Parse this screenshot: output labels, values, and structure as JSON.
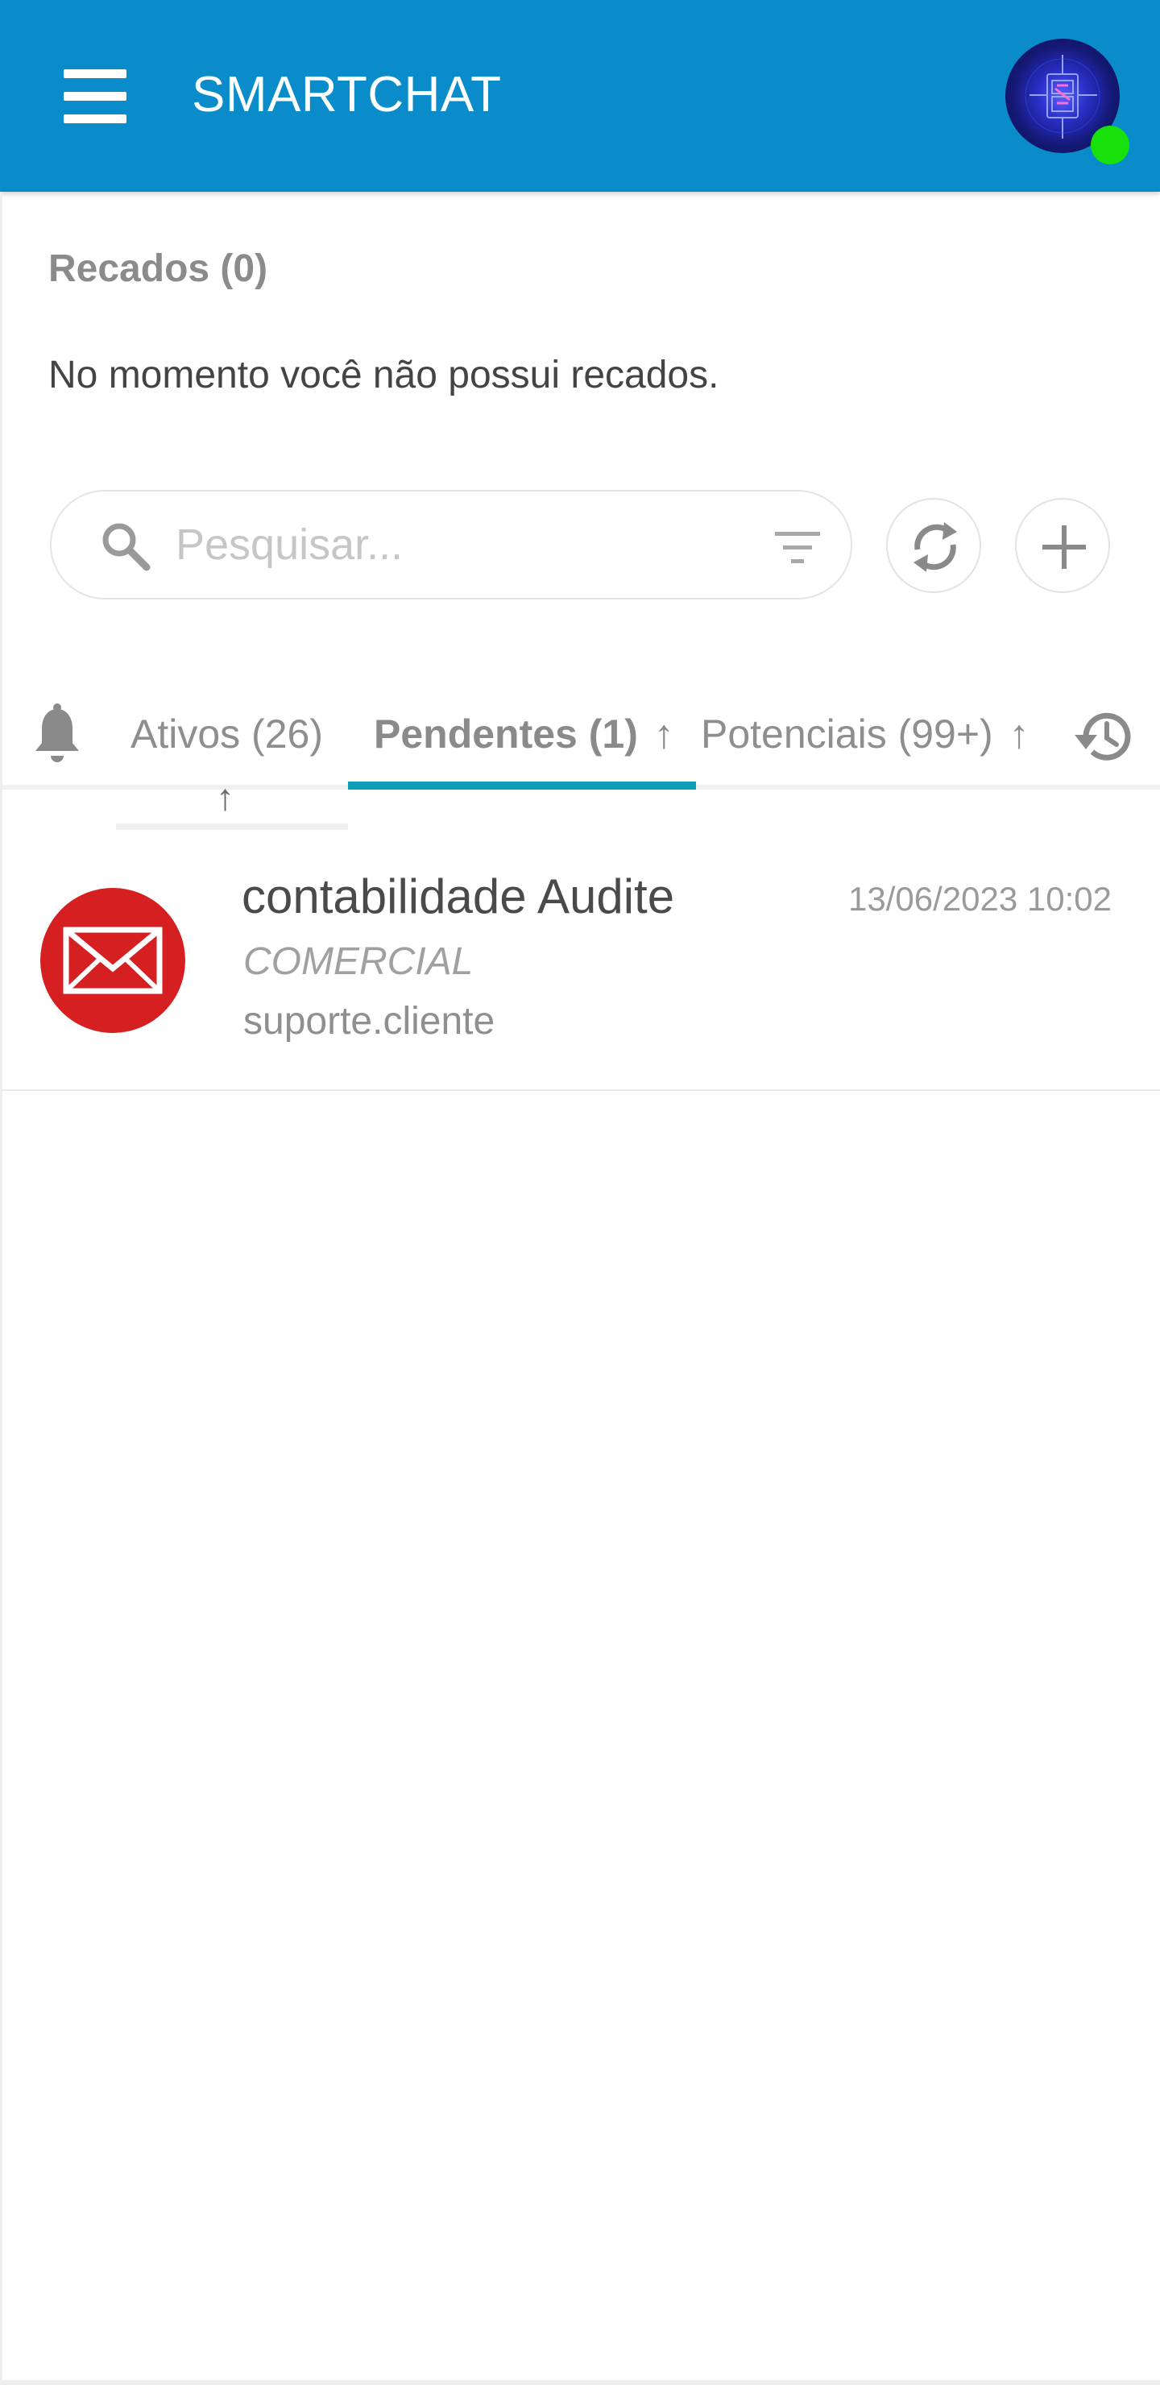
{
  "header": {
    "menu_icon": "hamburger-menu-icon",
    "title": "SMARTCHAT",
    "avatar_icon": "user-avatar",
    "status": "online",
    "status_color": "#17e00b",
    "background_color": "#0a8ccb"
  },
  "recados": {
    "title": "Recados (0)",
    "empty_message": "No momento você não possui recados."
  },
  "search": {
    "placeholder": "Pesquisar...",
    "value": "",
    "search_icon": "search-icon",
    "filter_icon": "filter-icon",
    "refresh_icon": "refresh-icon",
    "add_icon": "plus-icon"
  },
  "tabs": {
    "notifications_icon": "bell-icon",
    "history_icon": "history-icon",
    "active_color": "#0d9fb8",
    "items": [
      {
        "label": "Ativos (26)",
        "arrow": "↑",
        "active": false
      },
      {
        "label": "Pendentes (1)",
        "arrow": "↑",
        "active": true
      },
      {
        "label": "Potenciais (99+)",
        "arrow": "↑",
        "active": false
      }
    ]
  },
  "conversations": [
    {
      "icon": "mail-icon",
      "icon_color": "#d51f20",
      "name": "contabilidade Audite",
      "department": "COMERCIAL",
      "user": "suporte.cliente",
      "datetime": "13/06/2023 10:02"
    }
  ]
}
